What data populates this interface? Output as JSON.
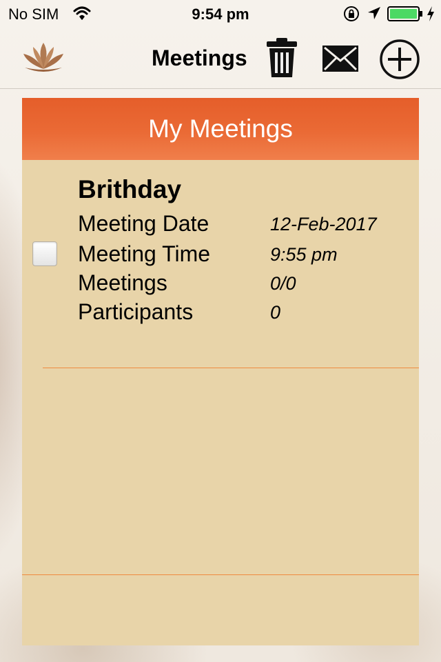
{
  "status_bar": {
    "carrier": "No SIM",
    "time": "9:54 pm",
    "battery_color": "#4cd964"
  },
  "nav": {
    "title": "Meetings"
  },
  "panel": {
    "title": "My Meetings",
    "header_color": "#e55e2a",
    "background_color": "#e8d4a9"
  },
  "meetings": [
    {
      "name": "Brithday",
      "checked": false,
      "rows": [
        {
          "label": "Meeting Date",
          "value": "12-Feb-2017"
        },
        {
          "label": "Meeting Time",
          "value": "9:55 pm"
        },
        {
          "label": "Meetings",
          "value": "0/0"
        },
        {
          "label": "Participants",
          "value": "0"
        }
      ]
    }
  ],
  "icons": {
    "logo": "lotus-logo-icon",
    "trash": "trash-icon",
    "mail": "mail-icon",
    "add": "plus-circle-icon"
  }
}
